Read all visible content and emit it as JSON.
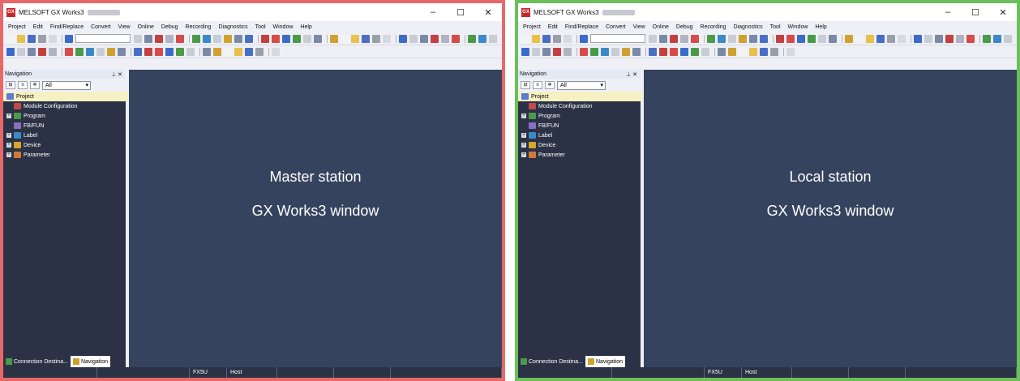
{
  "windows": [
    {
      "title": "MELSOFT GX Works3",
      "frame_color": "#e8686a",
      "caption_line1": "Master station",
      "caption_line2": "GX Works3 window"
    },
    {
      "title": "MELSOFT GX Works3",
      "frame_color": "#6cbf5a",
      "caption_line1": "Local station",
      "caption_line2": "GX Works3 window"
    }
  ],
  "menu": [
    "Project",
    "Edit",
    "Find/Replace",
    "Convert",
    "View",
    "Online",
    "Debug",
    "Recording",
    "Diagnostics",
    "Tool",
    "Window",
    "Help"
  ],
  "navigation": {
    "header": "Navigation",
    "pin_icon": "pin-icon",
    "filter": "All",
    "tree": [
      {
        "label": "Project",
        "icon": "project-icon",
        "expander": false,
        "selected": true
      },
      {
        "label": "Module Configuration",
        "icon": "module-config-icon",
        "expander": false,
        "selected": false
      },
      {
        "label": "Program",
        "icon": "program-icon",
        "expander": true,
        "selected": false
      },
      {
        "label": "FB/FUN",
        "icon": "fbfun-icon",
        "expander": false,
        "selected": false
      },
      {
        "label": "Label",
        "icon": "label-icon",
        "expander": true,
        "selected": false
      },
      {
        "label": "Device",
        "icon": "device-icon",
        "expander": true,
        "selected": false
      },
      {
        "label": "Parameter",
        "icon": "parameter-icon",
        "expander": true,
        "selected": false
      }
    ]
  },
  "tabs": [
    "Connection Destina...",
    "Navigation"
  ],
  "status": {
    "cpu": "FX5U",
    "connection": "Host"
  },
  "window_buttons": {
    "minimize": "–",
    "maximize": "☐",
    "close": "✕"
  },
  "colors": {
    "workspace": "#36435e",
    "nav_panel": "#2b3245",
    "selection": "#f6f1c2"
  }
}
